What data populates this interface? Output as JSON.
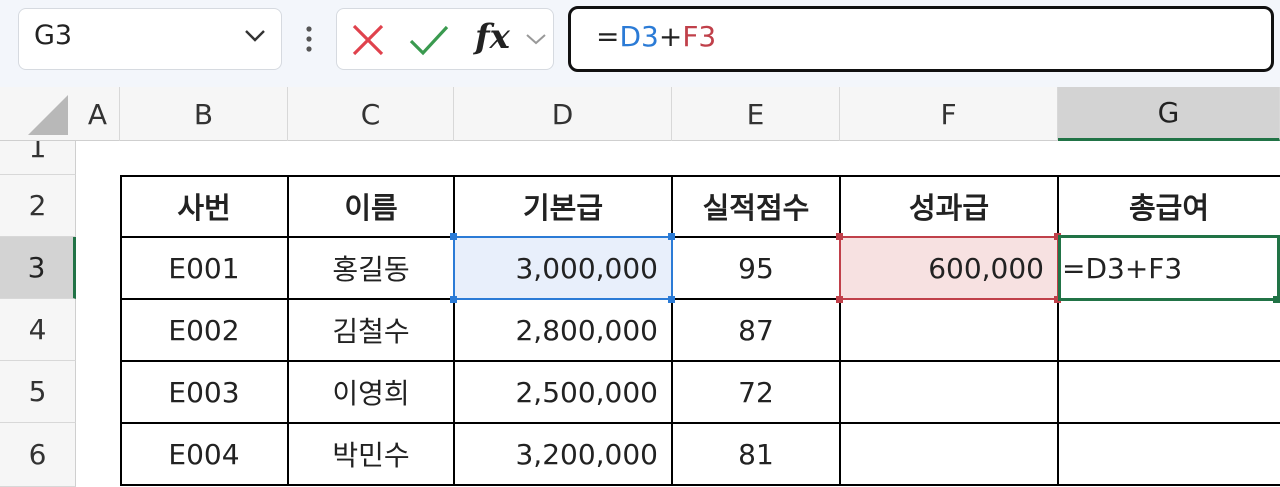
{
  "formula_bar": {
    "name_box": "G3",
    "fx_label": "fx",
    "formula_prefix": "=",
    "formula_ref1": "D3",
    "formula_op": "+",
    "formula_ref2": "F3"
  },
  "columns": [
    "A",
    "B",
    "C",
    "D",
    "E",
    "F",
    "G"
  ],
  "rows": [
    "1",
    "2",
    "3",
    "4",
    "5",
    "6"
  ],
  "table": {
    "headers": [
      "사번",
      "이름",
      "기본급",
      "실적점수",
      "성과급",
      "총급여"
    ],
    "rows": [
      [
        "E001",
        "홍길동",
        "3,000,000",
        "95",
        "600,000",
        "=D3+F3"
      ],
      [
        "E002",
        "김철수",
        "2,800,000",
        "87",
        "",
        ""
      ],
      [
        "E003",
        "이영희",
        "2,500,000",
        "72",
        "",
        ""
      ],
      [
        "E004",
        "박민수",
        "3,200,000",
        "81",
        "",
        ""
      ]
    ]
  },
  "colors": {
    "ref1": "#2b7bd6",
    "ref2": "#c0404a",
    "active": "#217346",
    "ref1_fill": "#e8effb",
    "ref2_fill": "#f7e1e1"
  },
  "selection": {
    "active_cell": "G3",
    "active_column": "G",
    "active_row": "3"
  }
}
